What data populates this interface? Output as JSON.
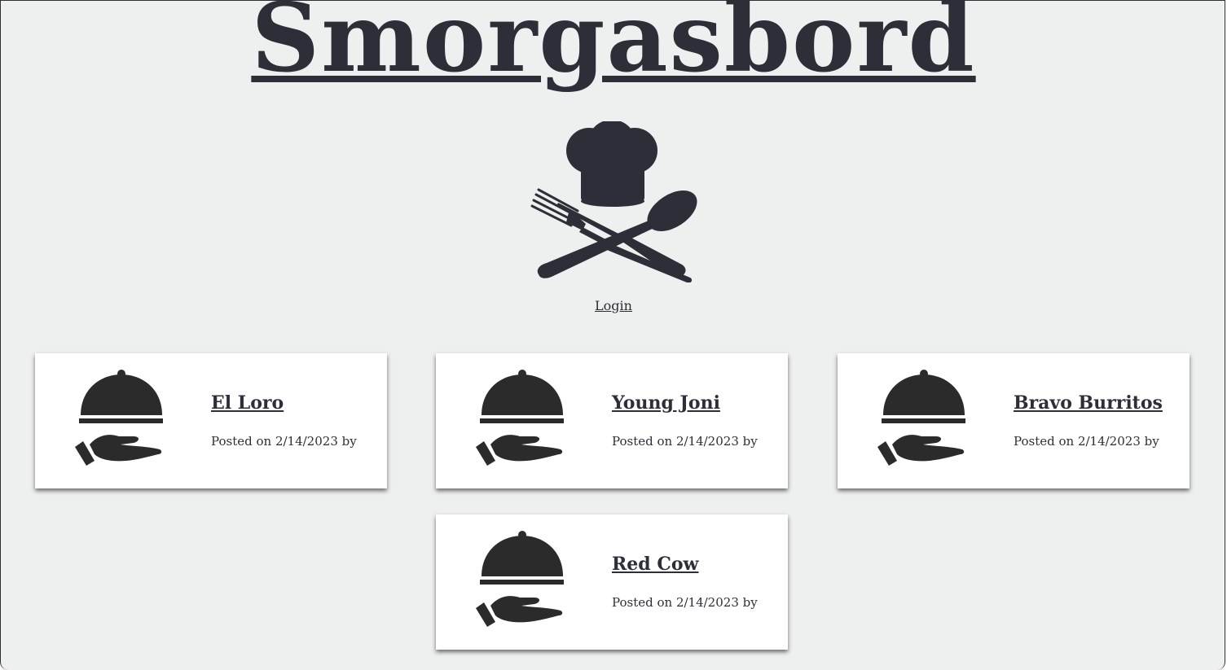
{
  "site": {
    "title": "Smorgasbord",
    "login_label": "Login"
  },
  "colors": {
    "text": "#2d2f38",
    "background": "#eef0ef",
    "card": "#ffffff"
  },
  "restaurants": [
    {
      "name": "El Loro",
      "posted_prefix": "Posted on",
      "date": "2/14/2023",
      "by": "by",
      "meta": "Posted on 2/14/2023 by",
      "icon": "serving-dish-icon"
    },
    {
      "name": "Young Joni",
      "posted_prefix": "Posted on",
      "date": "2/14/2023",
      "by": "by",
      "meta": "Posted on 2/14/2023 by",
      "icon": "serving-dish-icon"
    },
    {
      "name": "Bravo Burritos",
      "posted_prefix": "Posted on",
      "date": "2/14/2023",
      "by": "by",
      "meta": "Posted on 2/14/2023 by",
      "icon": "serving-dish-icon"
    },
    {
      "name": "Red Cow",
      "posted_prefix": "Posted on",
      "date": "2/14/2023",
      "by": "by",
      "meta": "Posted on 2/14/2023 by",
      "icon": "serving-dish-icon"
    }
  ]
}
